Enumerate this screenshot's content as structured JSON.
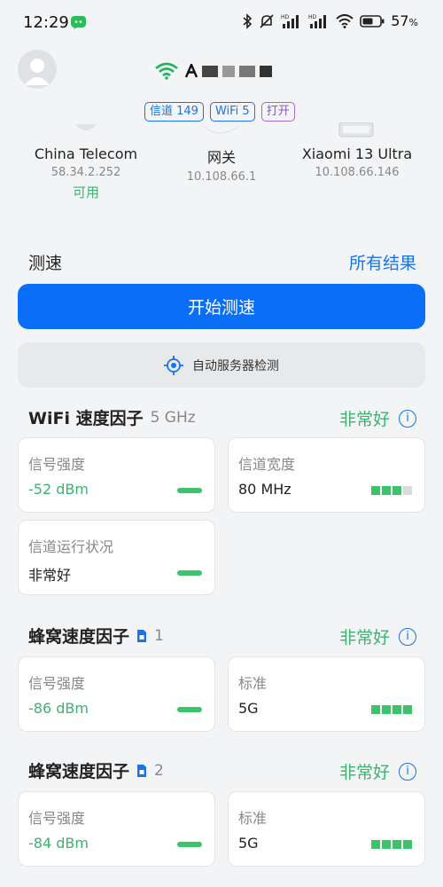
{
  "status_bar": {
    "time": "12:29",
    "battery": "57",
    "battery_unit": "%"
  },
  "network": {
    "badges": [
      "信道 149",
      "WiFi 5",
      "打开"
    ]
  },
  "nodes": [
    {
      "name": "China Telecom",
      "ip": "58.34.2.252",
      "state": "可用"
    },
    {
      "name": "网关",
      "ip": "10.108.66.1"
    },
    {
      "name": "Xiaomi 13 Ultra",
      "ip": "10.108.66.146"
    }
  ],
  "speedtest": {
    "label": "测速",
    "all_results": "所有结果",
    "start": "开始测速",
    "auto_server": "自动服务器检测"
  },
  "wifi_section": {
    "title": "WiFi 速度因子",
    "band": "5 GHz",
    "rating": "非常好",
    "info": "i",
    "cards": [
      {
        "key": "信号强度",
        "value": "-52 dBm",
        "indicator": "pill",
        "value_color": "green"
      },
      {
        "key": "信道宽度",
        "value": "80 MHz",
        "indicator": "bars",
        "bars_on": 3,
        "bars_total": 4
      },
      {
        "key": "信道运行状况",
        "value": "非常好",
        "indicator": "pill"
      }
    ]
  },
  "cellular_sections": [
    {
      "title": "蜂窝速度因子",
      "sim": "1",
      "rating": "非常好",
      "info": "i",
      "cards": [
        {
          "key": "信号强度",
          "value": "-86 dBm",
          "indicator": "pill",
          "value_color": "green"
        },
        {
          "key": "标准",
          "value": "5G",
          "indicator": "bars",
          "bars_on": 4,
          "bars_total": 4
        }
      ]
    },
    {
      "title": "蜂窝速度因子",
      "sim": "2",
      "rating": "非常好",
      "info": "i",
      "cards": [
        {
          "key": "信号强度",
          "value": "-84 dBm",
          "indicator": "pill",
          "value_color": "green"
        },
        {
          "key": "标准",
          "value": "5G",
          "indicator": "bars",
          "bars_on": 4,
          "bars_total": 4
        }
      ]
    }
  ],
  "icons": {
    "status": [
      "chat-app-icon",
      "bluetooth-icon",
      "mute-icon",
      "cellular-signal-icon",
      "wifi-icon",
      "battery-icon"
    ],
    "avatar": "user-avatar-icon",
    "auto_server": "locate-target-icon",
    "sim": "sim-card-icon",
    "info": "info-icon"
  },
  "colors": {
    "accent": "#0a6ff6",
    "good": "#3cb371",
    "indicator": "#3cc36b",
    "badge_blue": "#1a73e8",
    "badge_purple": "#9050d0"
  }
}
